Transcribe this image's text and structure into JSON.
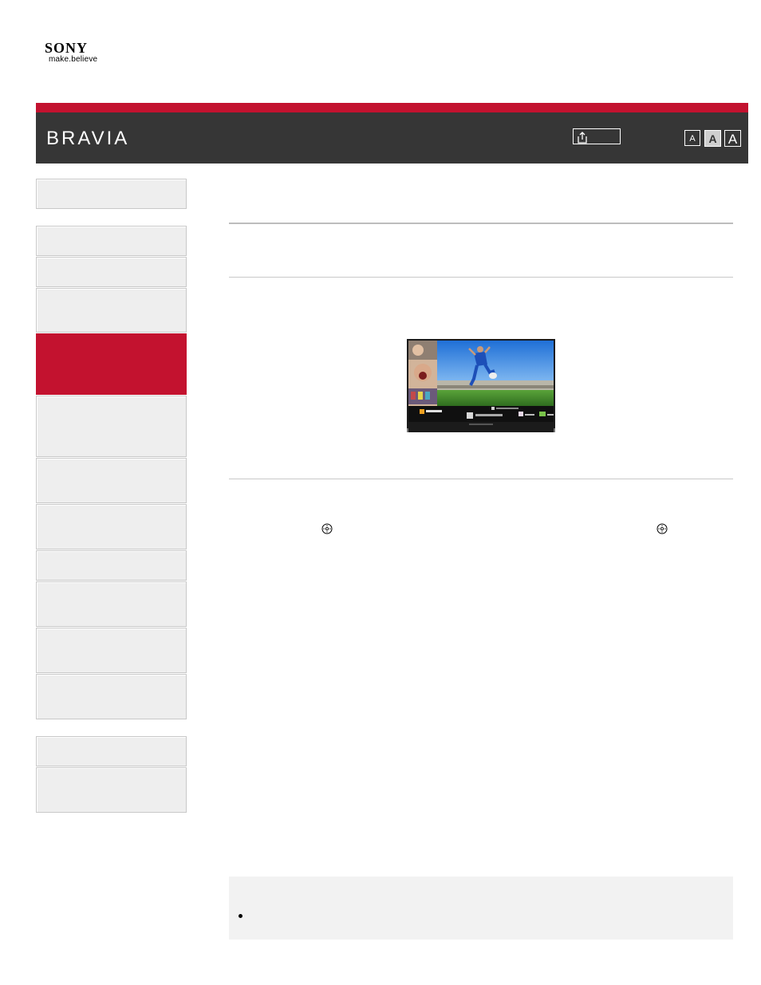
{
  "brand": {
    "company": "SONY",
    "tagline": "make.believe",
    "product": "BRAVIA"
  },
  "header": {
    "accent_color": "#c3122f",
    "band_color": "#363636",
    "print_icon": "print-icon",
    "font_size_buttons": [
      "A",
      "A",
      "A"
    ],
    "font_size_selected": "medium"
  },
  "sidebar": {
    "item_count": 17,
    "active_item_index": 4,
    "active_color": "#c3122f"
  },
  "content": {
    "illustration": "tv-screen-football-social-view",
    "inline_icons": [
      "remote-enter-icon",
      "remote-enter-icon"
    ],
    "note_bullets": 1
  }
}
